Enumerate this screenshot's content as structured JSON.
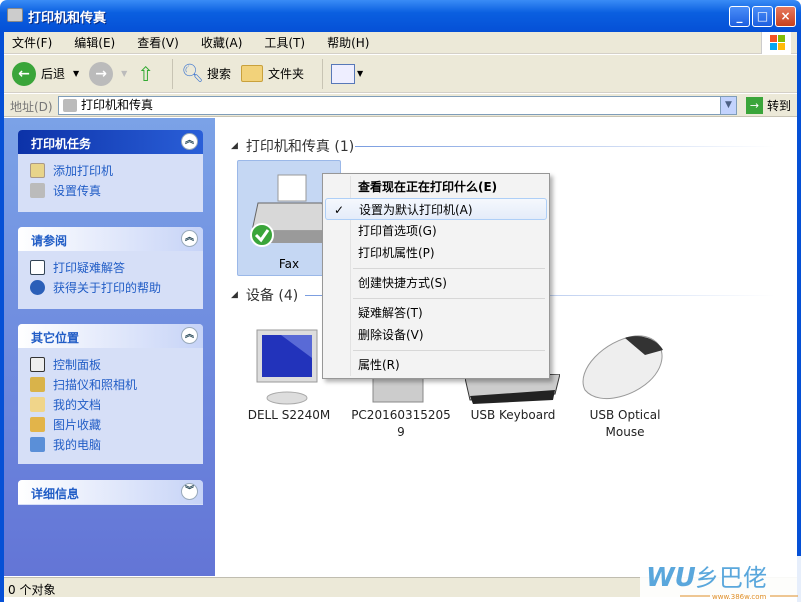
{
  "window": {
    "title": "打印机和传真",
    "minimize": "_",
    "maximize": "□",
    "close": "×"
  },
  "menu": [
    "文件(F)",
    "编辑(E)",
    "查看(V)",
    "收藏(A)",
    "工具(T)",
    "帮助(H)"
  ],
  "toolbar": {
    "back": "后退",
    "search": "搜索",
    "folders": "文件夹"
  },
  "address": {
    "label": "地址(D)",
    "value": "打印机和传真",
    "go": "转到"
  },
  "left": {
    "tasks": {
      "title": "打印机任务",
      "items": [
        "添加打印机",
        "设置传真"
      ]
    },
    "see_also": {
      "title": "请参阅",
      "items": [
        "打印疑难解答",
        "获得关于打印的帮助"
      ]
    },
    "other": {
      "title": "其它位置",
      "items": [
        "控制面板",
        "扫描仪和照相机",
        "我的文档",
        "图片收藏",
        "我的电脑"
      ]
    },
    "details": {
      "title": "详细信息"
    }
  },
  "main": {
    "printers_header": "打印机和传真 (1)",
    "fax_label": "Fax",
    "devices_header": "设备 (4)",
    "devices": [
      "DELL S2240M",
      "PC20160315205\n9",
      "USB Keyboard",
      "USB Optical\nMouse"
    ]
  },
  "context_menu": {
    "items": [
      "查看现在正在打印什么(E)",
      "设置为默认打印机(A)",
      "打印首选项(G)",
      "打印机属性(P)",
      "创建快捷方式(S)",
      "疑难解答(T)",
      "删除设备(V)",
      "属性(R)"
    ],
    "checked": "设置为默认打印机(A)",
    "check": "✓"
  },
  "status": {
    "text": "0 个对象"
  },
  "watermark": {
    "text": "WU乡巴佬",
    "url": "www.386w.com"
  }
}
